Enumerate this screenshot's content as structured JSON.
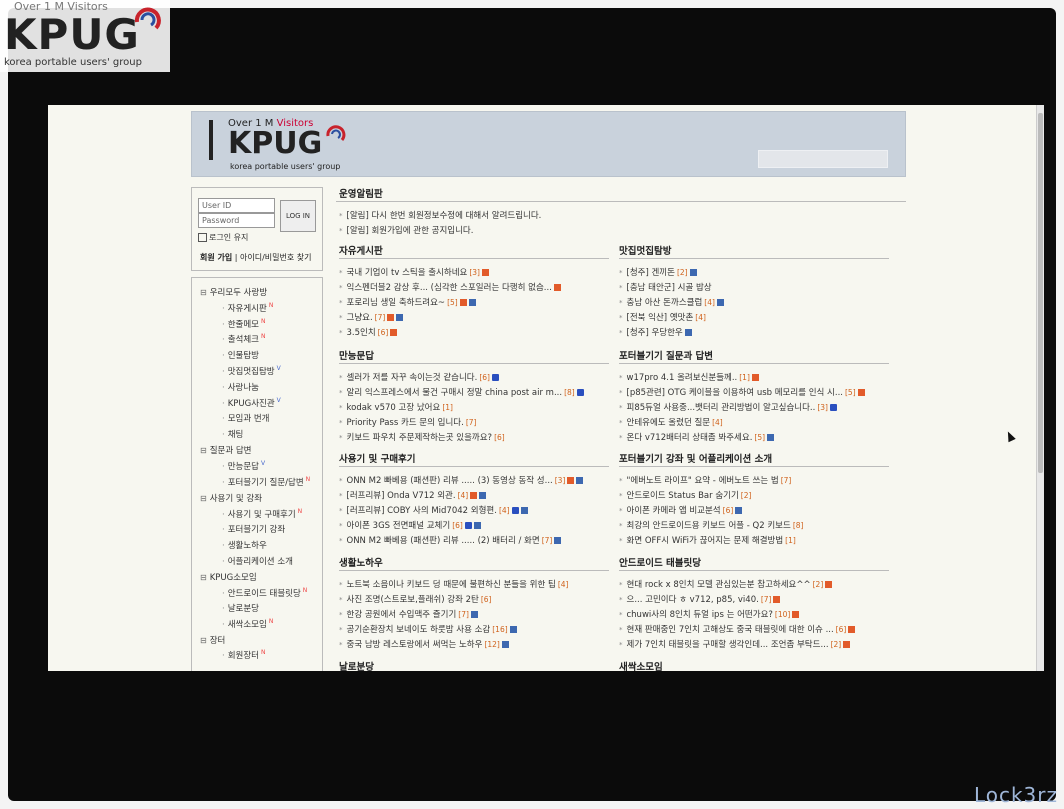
{
  "watermark": {
    "visitors": "Over 1 M Visitors",
    "logo": "KPUG",
    "tagline": "korea portable users' group"
  },
  "signature": "Lock3rz",
  "header": {
    "visitors_prefix": "Over 1 M ",
    "visitors_word": "Visitors",
    "logo": "KPUG",
    "tagline": "korea portable users' group"
  },
  "login": {
    "id_placeholder": "User ID",
    "pw_placeholder": "Password",
    "button": "LOG IN",
    "keep": "로그인 유지",
    "join": "회원 가입",
    "find": "아이디/비밀번호 찾기"
  },
  "nav": [
    {
      "label": "우리모두 사랑방",
      "kind": "cat",
      "badge": ""
    },
    {
      "label": "자유게시판",
      "kind": "sub",
      "badge": "N"
    },
    {
      "label": "한줄메모",
      "kind": "sub",
      "badge": "N"
    },
    {
      "label": "출석체크",
      "kind": "sub",
      "badge": "N"
    },
    {
      "label": "인물탐방",
      "kind": "sub",
      "badge": ""
    },
    {
      "label": "맛집멋집탐방",
      "kind": "sub",
      "badge": "V"
    },
    {
      "label": "사랑나눔",
      "kind": "sub",
      "badge": ""
    },
    {
      "label": "KPUG사진관",
      "kind": "sub",
      "badge": "V"
    },
    {
      "label": "모임과 번개",
      "kind": "sub",
      "badge": ""
    },
    {
      "label": "채팅",
      "kind": "sub",
      "badge": ""
    },
    {
      "label": "질문과 답변",
      "kind": "cat",
      "badge": ""
    },
    {
      "label": "만능문답",
      "kind": "sub",
      "badge": "V"
    },
    {
      "label": "포터블기기 질문/답변",
      "kind": "sub",
      "badge": "N"
    },
    {
      "label": "사용기 및 강좌",
      "kind": "cat",
      "badge": ""
    },
    {
      "label": "사용기 및 구매후기",
      "kind": "sub",
      "badge": "N"
    },
    {
      "label": "포터블기기 강좌",
      "kind": "sub",
      "badge": ""
    },
    {
      "label": "생활노하우",
      "kind": "sub",
      "badge": ""
    },
    {
      "label": "어플리케이션 소개",
      "kind": "sub",
      "badge": ""
    },
    {
      "label": "KPUG소모임",
      "kind": "cat",
      "badge": ""
    },
    {
      "label": "안드로이드 태블릿당",
      "kind": "sub",
      "badge": "N"
    },
    {
      "label": "날로분당",
      "kind": "sub",
      "badge": ""
    },
    {
      "label": "새싹소모임",
      "kind": "sub",
      "badge": "N"
    },
    {
      "label": "장터",
      "kind": "cat",
      "badge": ""
    },
    {
      "label": "회원장터",
      "kind": "sub",
      "badge": "N"
    }
  ],
  "notice": {
    "title": "운영알림판",
    "items": [
      "[알림] 다시 한번 회원정보수정에 대해서 알려드립니다.",
      "[알림] 회원가입에 관한 공지입니다."
    ]
  },
  "boards": [
    {
      "title": "자유게시판",
      "posts": [
        {
          "text": "국내 기업이 tv 스틱을 출시하네요",
          "count": "[3]",
          "icons": [
            "n"
          ]
        },
        {
          "text": "익스펜더블2 감상 후... (심각한 스포일러는 다행히 없슴...",
          "count": "",
          "icons": [
            "n"
          ]
        },
        {
          "text": "포로리님 생일 축하드려요~",
          "count": "[5]",
          "icons": [
            "n",
            "d"
          ]
        },
        {
          "text": "그냥요.",
          "count": "[7]",
          "icons": [
            "n",
            "d"
          ]
        },
        {
          "text": "3.5인치",
          "count": "[6]",
          "icons": [
            "n"
          ]
        }
      ]
    },
    {
      "title": "맛집멋집탐방",
      "posts": [
        {
          "text": "[청주] 겐끼돈",
          "count": "[2]",
          "icons": [
            "d"
          ]
        },
        {
          "text": "[충남 태안군] 시골 밥상",
          "count": "",
          "icons": []
        },
        {
          "text": "충남 아산 돈까스클럽",
          "count": "[4]",
          "icons": [
            "d"
          ]
        },
        {
          "text": "[전북 익산] 옛맛촌",
          "count": "[4]",
          "icons": []
        },
        {
          "text": "[청주] 우당한우",
          "count": "",
          "icons": [
            "d"
          ]
        }
      ]
    },
    {
      "title": "만능문답",
      "posts": [
        {
          "text": "셀러가 저를 자꾸 속이는것 같습니다.",
          "count": "[6]",
          "icons": [
            "v"
          ]
        },
        {
          "text": "알리 익스프레스에서 물건 구매시 정말 china post air m...",
          "count": "[8]",
          "icons": [
            "v"
          ]
        },
        {
          "text": "kodak v570 고장 났어요",
          "count": "[1]",
          "icons": []
        },
        {
          "text": "Priority Pass 카드 문의 입니다.",
          "count": "[7]",
          "icons": []
        },
        {
          "text": "키보드 파우치 주문제작하는곳 있을까요?",
          "count": "[6]",
          "icons": []
        }
      ]
    },
    {
      "title": "포터블기기 질문과 답변",
      "posts": [
        {
          "text": "w17pro 4.1 올려보신분들께..",
          "count": "[1]",
          "icons": [
            "n"
          ]
        },
        {
          "text": "[p85관련] OTG 케이블을 이용하여 usb 메모리를 인식 시...",
          "count": "[5]",
          "icons": [
            "n"
          ]
        },
        {
          "text": "피85듀얼 사용중...뱃터리 관리방법이 알고싶습니다..",
          "count": "[3]",
          "icons": [
            "v"
          ]
        },
        {
          "text": "안테유에도 올렸던 질문",
          "count": "[4]",
          "icons": []
        },
        {
          "text": "온다 v712배터리 상태좀 봐주세요.",
          "count": "[5]",
          "icons": [
            "d"
          ]
        }
      ]
    },
    {
      "title": "사용기 및 구매후기",
      "posts": [
        {
          "text": "ONN M2 빠베용 (패션판) 리뷰 ..... (3) 동영상 동작 성...",
          "count": "[3]",
          "icons": [
            "n",
            "d"
          ]
        },
        {
          "text": "[러프리뷰] Onda V712 외관.",
          "count": "[4]",
          "icons": [
            "n",
            "d"
          ]
        },
        {
          "text": "[러프리뷰] COBY 사의 Mid7042 외형편.",
          "count": "[4]",
          "icons": [
            "v",
            "d"
          ]
        },
        {
          "text": "아이폰 3GS 전면패널 교체기",
          "count": "[6]",
          "icons": [
            "v",
            "d"
          ]
        },
        {
          "text": "ONN M2 빠베용 (패션판) 리뷰 ..... (2) 배터리 / 화면",
          "count": "[7]",
          "icons": [
            "d"
          ]
        }
      ]
    },
    {
      "title": "포터블기기 강좌 및 어플리케이션 소개",
      "posts": [
        {
          "text": "\"에버노트 라이프\" 요약 - 에버노트 쓰는 법",
          "count": "[7]",
          "icons": []
        },
        {
          "text": "안드로이드 Status Bar 숨기기",
          "count": "[2]",
          "icons": []
        },
        {
          "text": "아이폰 카메라 앱 비교분석",
          "count": "[6]",
          "icons": [
            "d"
          ]
        },
        {
          "text": "최강의 안드로이드용 키보드 어플 - Q2 키보드",
          "count": "[8]",
          "icons": []
        },
        {
          "text": "화면 OFF시 WiFi가 끊어지는 문제 해결방법",
          "count": "[1]",
          "icons": []
        }
      ]
    },
    {
      "title": "생활노하우",
      "posts": [
        {
          "text": "노트북 소음이나 키보드 덩 때문에 불편하신 분들을 위한 팁",
          "count": "[4]",
          "icons": []
        },
        {
          "text": "사진 조명(스트로보,플래쉬) 강좌 2탄",
          "count": "[6]",
          "icons": []
        },
        {
          "text": "한강 공원에서 수입맥주 즐기기",
          "count": "[7]",
          "icons": [
            "d"
          ]
        },
        {
          "text": "공기순환장치 보네이도 하룻밤 사용 소감",
          "count": "[16]",
          "icons": [
            "d"
          ]
        },
        {
          "text": "중국 남방 레스토랑에서 써먹는 노하우",
          "count": "[12]",
          "icons": [
            "d"
          ]
        }
      ]
    },
    {
      "title": "안드로이드 태블릿당",
      "posts": [
        {
          "text": "현대 rock x 8인치 모델 관심있는분 참고하세요^^",
          "count": "[2]",
          "icons": [
            "n"
          ]
        },
        {
          "text": "으... 고민이다 ㅎ v712, p85, vi40.",
          "count": "[7]",
          "icons": [
            "n"
          ]
        },
        {
          "text": "chuwi사의 8인치 듀얼 ips 는 어떤가요?",
          "count": "[10]",
          "icons": [
            "n"
          ]
        },
        {
          "text": "현재 판매중인 7인치 고해상도 중국 태블릿에 대한 이슈 ...",
          "count": "[6]",
          "icons": [
            "n"
          ]
        },
        {
          "text": "제가 7인치 태블릿을 구매할 생각인데... 조언좀 부탁드...",
          "count": "[2]",
          "icons": [
            "n"
          ]
        }
      ]
    },
    {
      "title": "날로분당",
      "posts": []
    },
    {
      "title": "새싹소모임",
      "posts": []
    }
  ]
}
